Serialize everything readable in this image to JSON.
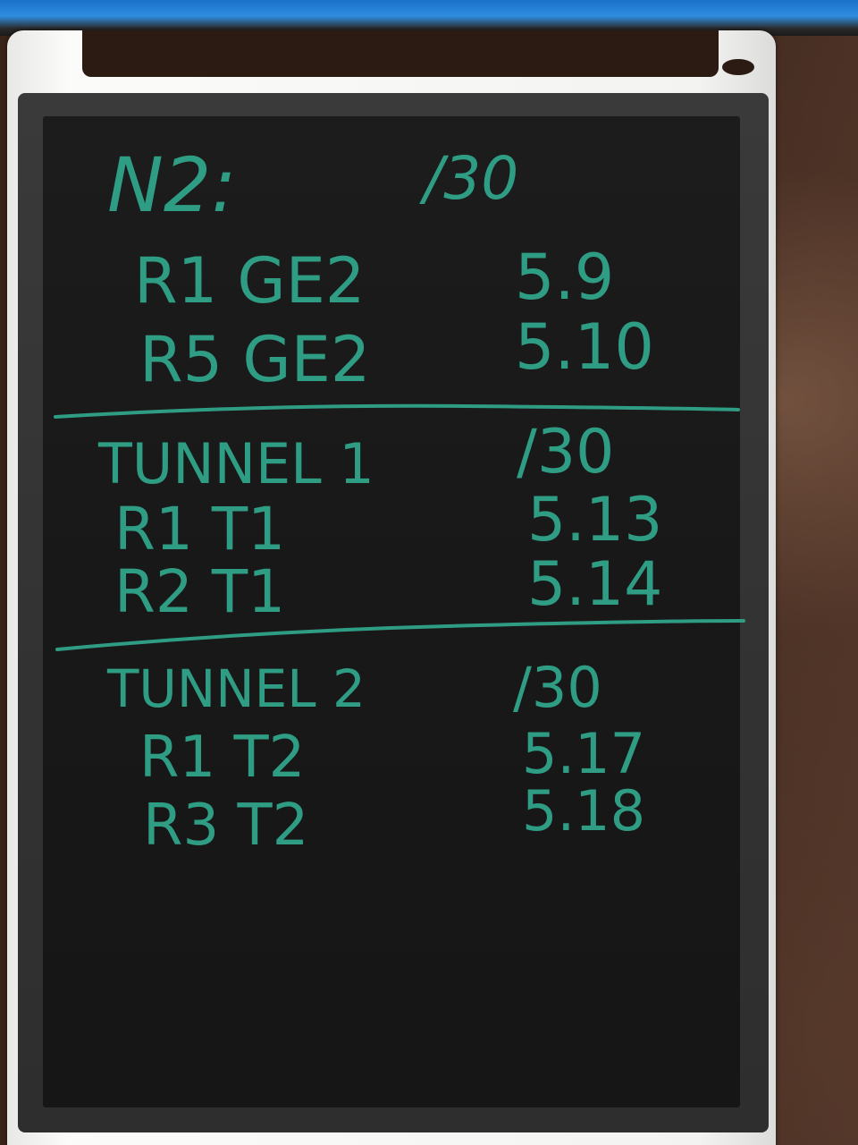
{
  "sections": [
    {
      "header": {
        "label": "N2:",
        "value": "/30"
      },
      "rows": [
        {
          "label": "R1 GE2",
          "value": "5.9"
        },
        {
          "label": "R5 GE2",
          "value": "5.10"
        }
      ]
    },
    {
      "header": {
        "label": "TUNNEL 1",
        "value": "/30"
      },
      "rows": [
        {
          "label": "R1 T1",
          "value": "5.13"
        },
        {
          "label": "R2 T1",
          "value": "5.14"
        }
      ]
    },
    {
      "header": {
        "label": "TUNNEL 2",
        "value": "/30"
      },
      "rows": [
        {
          "label": "R1 T2",
          "value": "5.17"
        },
        {
          "label": "R3 T2",
          "value": "5.18"
        }
      ]
    }
  ],
  "colors": {
    "ink": "#2f9c84",
    "screen": "#181818",
    "bezel": "#333333",
    "frame": "#f4f4f2",
    "desk": "#3a2418"
  }
}
